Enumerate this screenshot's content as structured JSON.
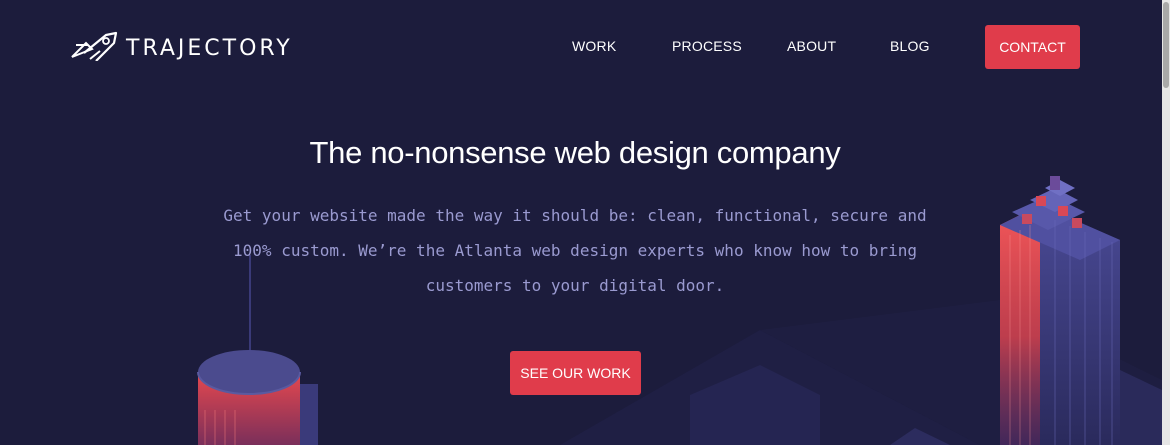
{
  "brand": {
    "name": "TRAJECTORY",
    "logo_icon": "rocket-logo-icon"
  },
  "nav": {
    "items": [
      {
        "label": "WORK"
      },
      {
        "label": "PROCESS"
      },
      {
        "label": "ABOUT"
      },
      {
        "label": "BLOG"
      }
    ],
    "contact_label": "CONTACT"
  },
  "hero": {
    "headline": "The no-nonsense web design company",
    "subcopy": "Get your website made the way it should be: clean, functional, secure and 100% custom. We’re the Atlanta web design experts who know how to bring customers to your digital door.",
    "cta_label": "SEE OUR WORK"
  },
  "colors": {
    "background": "#1c1c3c",
    "accent": "#e03c4b",
    "subcopy": "#9a9ad0"
  }
}
